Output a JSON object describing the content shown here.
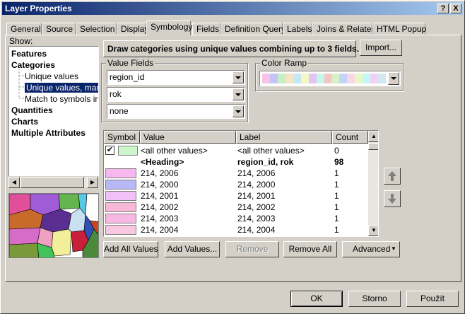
{
  "window": {
    "title": "Layer Properties",
    "help_label": "?",
    "close_label": "X"
  },
  "tabs": [
    {
      "label": "General"
    },
    {
      "label": "Source"
    },
    {
      "label": "Selection"
    },
    {
      "label": "Display"
    },
    {
      "label": "Symbology"
    },
    {
      "label": "Fields"
    },
    {
      "label": "Definition Query"
    },
    {
      "label": "Labels"
    },
    {
      "label": "Joins & Relates"
    },
    {
      "label": "HTML Popup"
    }
  ],
  "show_panel": {
    "label": "Show:",
    "items": [
      {
        "label": "Features"
      },
      {
        "label": "Categories"
      },
      {
        "label": "Unique values"
      },
      {
        "label": "Unique values, many"
      },
      {
        "label": "Match to symbols in a"
      },
      {
        "label": "Quantities"
      },
      {
        "label": "Charts"
      },
      {
        "label": "Multiple Attributes"
      }
    ]
  },
  "description": "Draw categories using unique values combining up to 3 fields.",
  "import_label": "Import...",
  "value_fields": {
    "label": "Value Fields",
    "fields": [
      {
        "value": "region_id"
      },
      {
        "value": "rok"
      },
      {
        "value": "none"
      }
    ]
  },
  "color_ramp": {
    "label": "Color Ramp",
    "colors": [
      "#f7c4e4",
      "#c4c4f7",
      "#c4f0c4",
      "#f7e4c4",
      "#c4e8f7",
      "#f7f7c4",
      "#e4c4f7",
      "#c4f7e8",
      "#f7c4c4",
      "#d8f0c4",
      "#c4d4f7",
      "#f7d8e8",
      "#e8f7c4",
      "#c4f7f7",
      "#f0d0f7",
      "#d0e8f0"
    ]
  },
  "table": {
    "headers": {
      "symbol": "Symbol",
      "value": "Value",
      "label": "Label",
      "count": "Count"
    },
    "other": {
      "value": "<all other values>",
      "label": "<all other values>",
      "count": "0",
      "color": "#ccf5cc"
    },
    "heading": {
      "value": "<Heading>",
      "label": "region_id, rok",
      "count": "98"
    },
    "rows": [
      {
        "value": "214, 2006",
        "label": "214, 2006",
        "count": "1",
        "color": "#f7b8f0"
      },
      {
        "value": "214, 2000",
        "label": "214, 2000",
        "count": "1",
        "color": "#b8b8f7"
      },
      {
        "value": "214, 2001",
        "label": "214, 2001",
        "count": "1",
        "color": "#f0c0f7"
      },
      {
        "value": "214, 2002",
        "label": "214, 2002",
        "count": "1",
        "color": "#f7b8d8"
      },
      {
        "value": "214, 2003",
        "label": "214, 2003",
        "count": "1",
        "color": "#f7b8e4"
      },
      {
        "value": "214, 2004",
        "label": "214, 2004",
        "count": "1",
        "color": "#f7c8e0"
      }
    ]
  },
  "buttons": {
    "add_all": "Add All Values",
    "add_values": "Add Values...",
    "remove": "Remove",
    "remove_all": "Remove All",
    "advanced": "Advanced"
  },
  "footer": {
    "ok": "OK",
    "cancel": "Storno",
    "apply": "Použít"
  }
}
